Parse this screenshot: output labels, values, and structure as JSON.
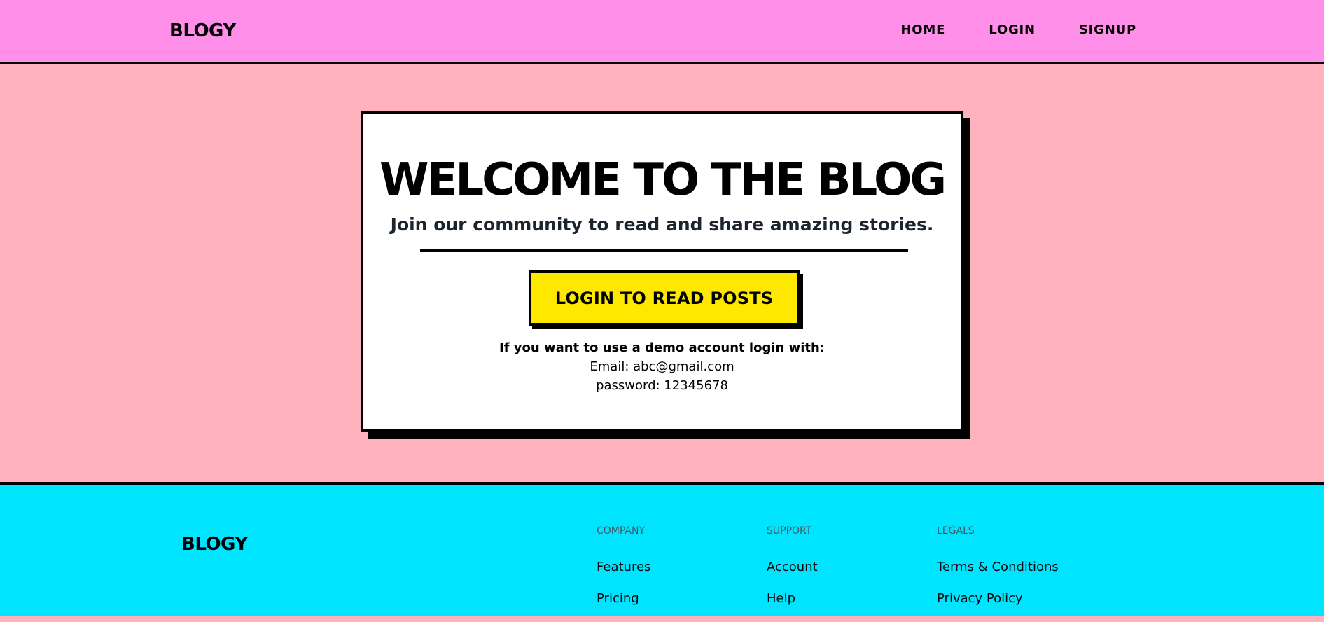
{
  "header": {
    "logo": "BLOGY",
    "nav": [
      {
        "label": "HOME"
      },
      {
        "label": "LOGIN"
      },
      {
        "label": "SIGNUP"
      }
    ]
  },
  "hero": {
    "title": "WELCOME TO THE BLOG",
    "subtitle": "Join our community to read and share amazing stories.",
    "cta_label": "LOGIN TO READ POSTS",
    "demo_heading": "If you want to use a demo account login with:",
    "demo_email": "Email: abc@gmail.com",
    "demo_password": "password: 12345678"
  },
  "footer": {
    "logo": "BLOGY",
    "columns": [
      {
        "heading": "COMPANY",
        "links": [
          "Features",
          "Pricing"
        ]
      },
      {
        "heading": "SUPPORT",
        "links": [
          "Account",
          "Help"
        ]
      },
      {
        "heading": "LEGALS",
        "links": [
          "Terms & Conditions",
          "Privacy Policy"
        ]
      }
    ]
  },
  "colors": {
    "header_bg": "#ff8fe8",
    "page_bg": "#ffb1bd",
    "card_bg": "#ffffff",
    "cta_bg": "#ffe800",
    "footer_bg": "#00e5ff",
    "border": "#000000"
  }
}
